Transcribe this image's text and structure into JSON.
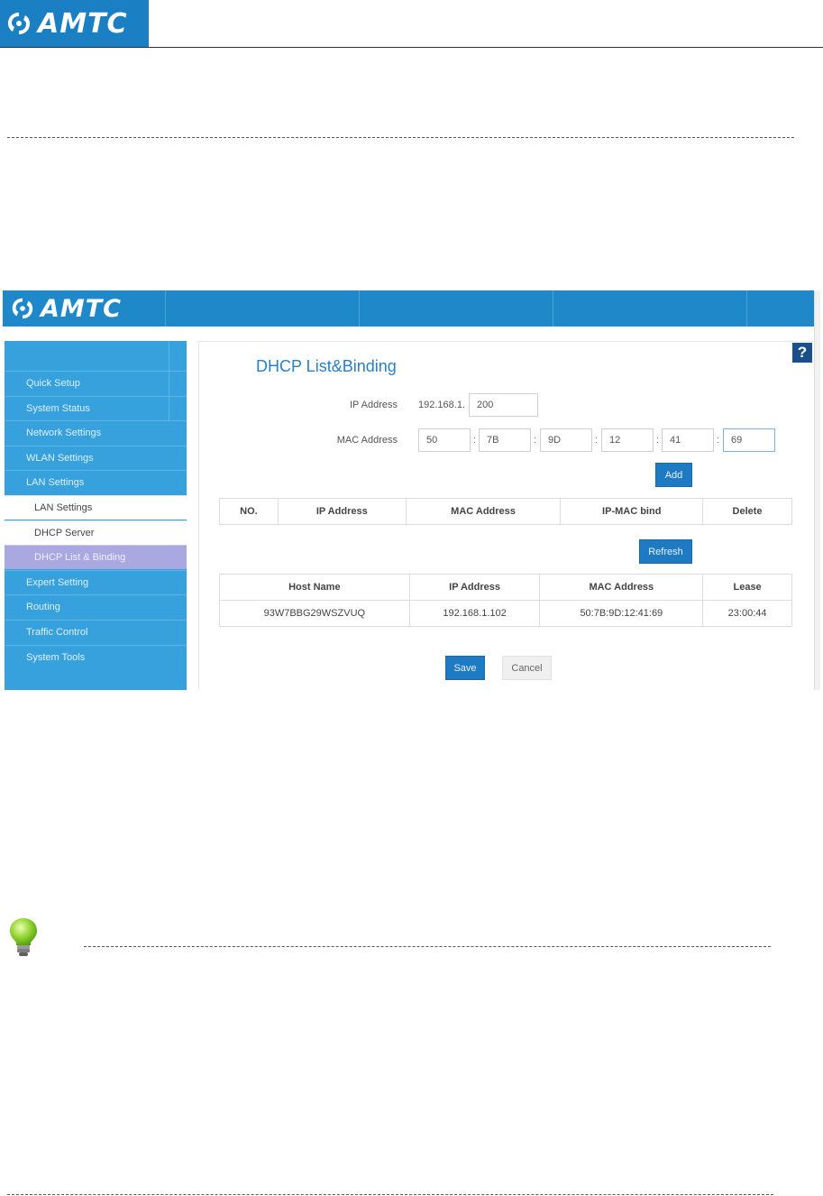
{
  "doc": {
    "logo_text": "AMTC"
  },
  "router": {
    "logo_text": "AMTC",
    "help_label": "?",
    "page_title": "DHCP List&Binding",
    "sidebar": {
      "items": [
        {
          "label": "Quick Setup"
        },
        {
          "label": "System Status"
        },
        {
          "label": "Network Settings"
        },
        {
          "label": "WLAN Settings"
        },
        {
          "label": "LAN Settings"
        },
        {
          "label": "LAN Settings"
        },
        {
          "label": "DHCP Server"
        },
        {
          "label": "DHCP List & Binding"
        },
        {
          "label": "Expert Setting"
        },
        {
          "label": "Routing"
        },
        {
          "label": "Traffic Control"
        },
        {
          "label": "System Tools"
        }
      ]
    },
    "form": {
      "ip_label": "IP Address",
      "ip_prefix": "192.168.1.",
      "ip_last": "200",
      "mac_label": "MAC Address",
      "mac_sep": ":",
      "mac_octets": [
        "50",
        "7B",
        "9D",
        "12",
        "41",
        "69"
      ],
      "add_label": "Add",
      "refresh_label": "Refresh",
      "save_label": "Save",
      "cancel_label": "Cancel"
    },
    "binding_table": {
      "headers": [
        "NO.",
        "IP Address",
        "MAC Address",
        "IP-MAC bind",
        "Delete"
      ]
    },
    "client_table": {
      "headers": [
        "Host Name",
        "IP Address",
        "MAC Address",
        "Lease"
      ],
      "rows": [
        [
          "93W7BBG29WSZVUQ",
          "192.168.1.102",
          "50:7B:9D:12:41:69",
          "23:00:44"
        ]
      ]
    }
  }
}
